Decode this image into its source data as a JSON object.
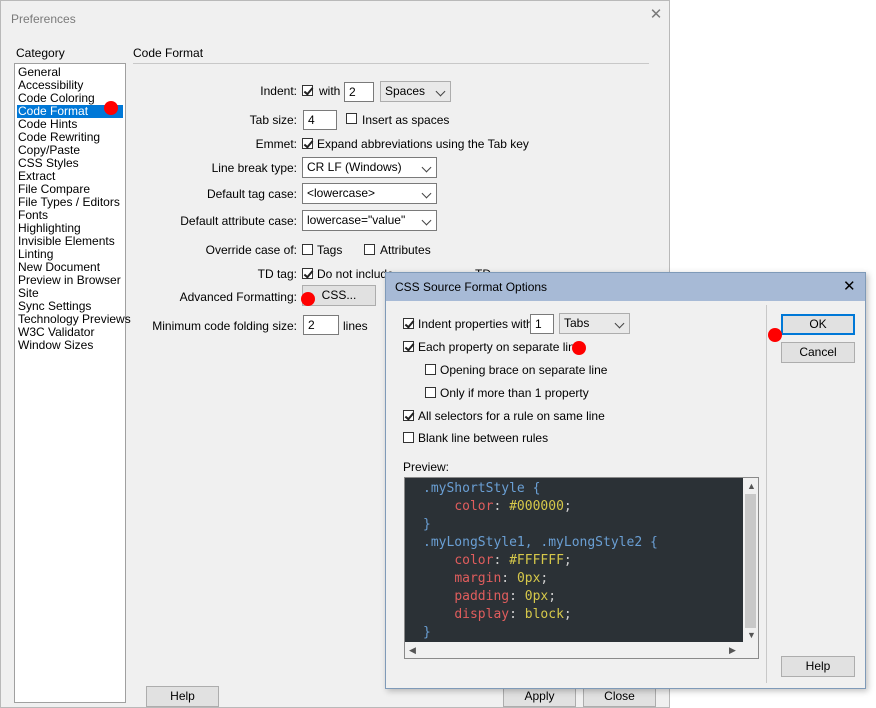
{
  "preferences": {
    "title": "Preferences",
    "category_heading": "Category",
    "section_heading": "Code Format",
    "categories": [
      "General",
      "Accessibility",
      "Code Coloring",
      "Code Format",
      "Code Hints",
      "Code Rewriting",
      "Copy/Paste",
      "CSS Styles",
      "Extract",
      "File Compare",
      "File Types / Editors",
      "Fonts",
      "Highlighting",
      "Invisible Elements",
      "Linting",
      "New Document",
      "Preview in Browser",
      "Site",
      "Sync Settings",
      "Technology Previews",
      "W3C Validator",
      "Window Sizes"
    ],
    "selected_category": "Code Format",
    "indent": {
      "label": "Indent:",
      "with_label": "with",
      "value": "2",
      "unit": "Spaces",
      "checked": true
    },
    "tab_size": {
      "label": "Tab size:",
      "value": "4",
      "insert_spaces_label": "Insert as spaces",
      "insert_spaces_checked": false
    },
    "emmet": {
      "label": "Emmet:",
      "option_label": "Expand abbreviations using the Tab key",
      "checked": true
    },
    "line_break": {
      "label": "Line break type:",
      "value": "CR LF (Windows)"
    },
    "tag_case": {
      "label": "Default tag case:",
      "value": "<lowercase>"
    },
    "attr_case": {
      "label": "Default attribute case:",
      "value": "lowercase=\"value\""
    },
    "override_case": {
      "label": "Override case of:",
      "tags_label": "Tags",
      "attributes_label": "Attributes",
      "tags_checked": false,
      "attributes_checked": false
    },
    "td_tag": {
      "label": "TD tag:",
      "option_label": "Do not include",
      "trailing_text": "TD",
      "checked": true
    },
    "advanced": {
      "label": "Advanced Formatting:",
      "css_button": "CSS..."
    },
    "folding": {
      "label": "Minimum code folding size:",
      "value": "2",
      "unit": "lines"
    },
    "help_button": "Help",
    "apply_button": "Apply",
    "close_button": "Close"
  },
  "css_dialog": {
    "title": "CSS Source Format Options",
    "indent_label": "Indent properties with",
    "indent_value": "1",
    "indent_unit": "Tabs",
    "indent_checked": true,
    "each_property_label": "Each property on separate line",
    "each_property_checked": true,
    "opening_brace_label": "Opening brace on separate line",
    "opening_brace_checked": false,
    "only_if_more_label": "Only if more than 1 property",
    "only_if_more_checked": false,
    "all_selectors_label": "All selectors for a rule on same line",
    "all_selectors_checked": true,
    "blank_line_label": "Blank line between rules",
    "blank_line_checked": false,
    "preview_label": "Preview:",
    "ok_button": "OK",
    "cancel_button": "Cancel",
    "help_button": "Help",
    "preview_code": {
      "sel1": ".myShortStyle",
      "brace_open": "{",
      "brace_close": "}",
      "prop_color": "color",
      "val_color1": "#000000",
      "sel2": ".myLongStyle1, .myLongStyle2",
      "val_color2": "#FFFFFF",
      "prop_margin": "margin",
      "val_margin": "0px",
      "prop_padding": "padding",
      "val_padding": "0px",
      "prop_display": "display",
      "val_display": "block",
      "colon": ":",
      "semicolon": ";"
    }
  },
  "colors": {
    "selection": "#0078d7",
    "dialog_titlebar": "#a7bad6",
    "annotation_dot": "#ff0000",
    "preview_bg": "#2b3136"
  }
}
